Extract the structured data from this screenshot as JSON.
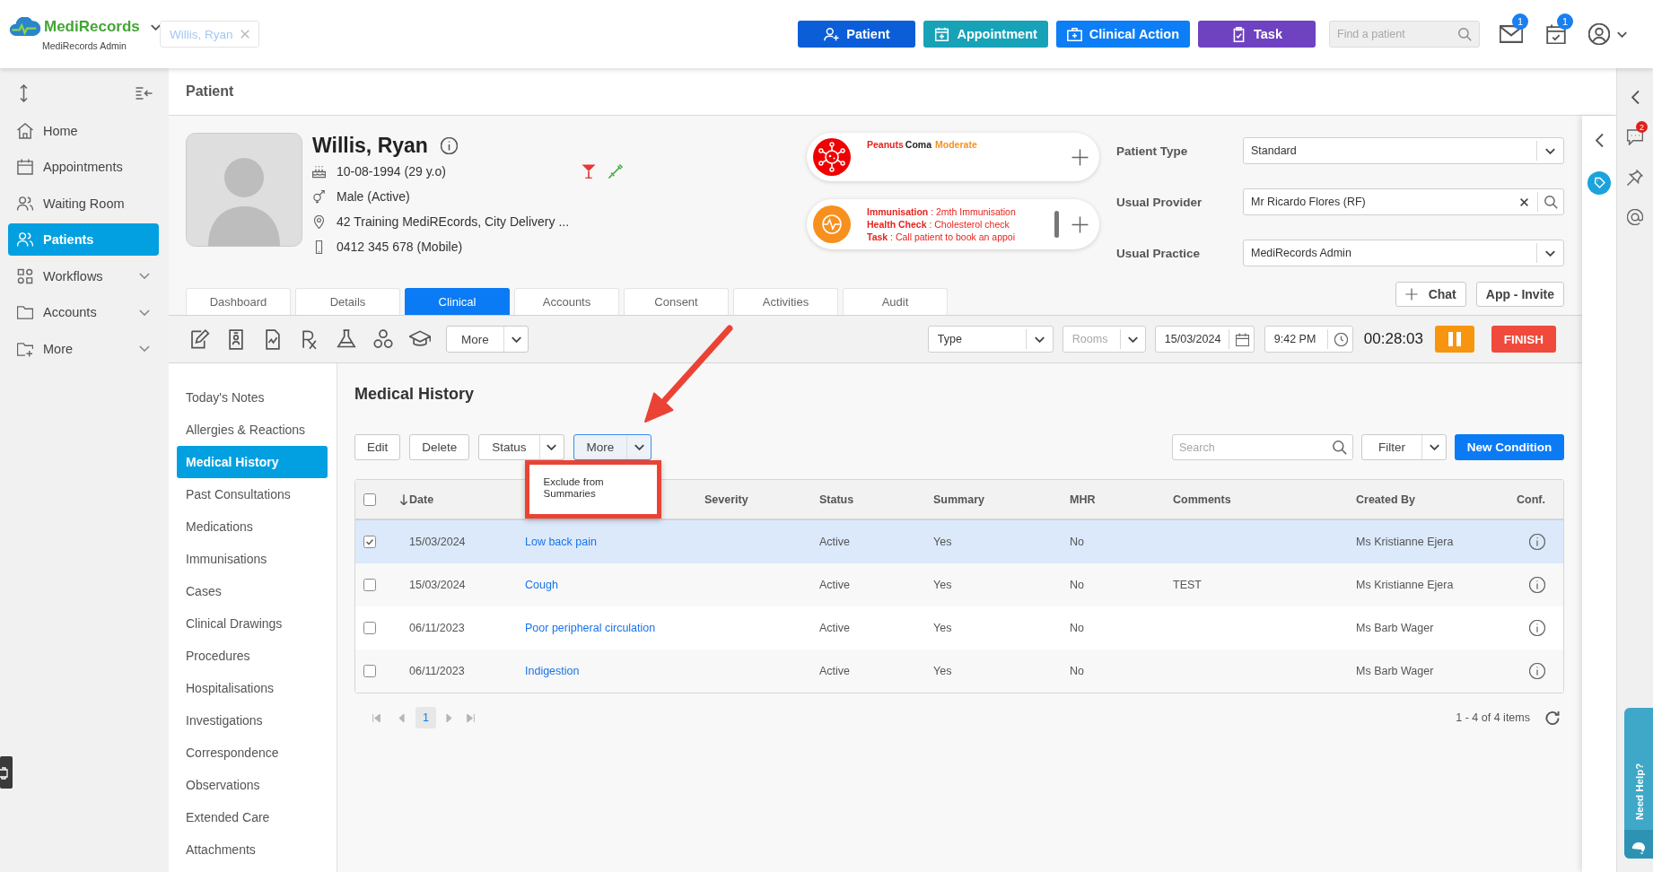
{
  "top_bar": {
    "brand": "MediRecords",
    "organisation": "MediRecords Admin",
    "open_patient": "Willis, Ryan",
    "actions": [
      {
        "label": "Patient",
        "color": "#0b5ed7"
      },
      {
        "label": "Appointment",
        "color": "#17a2b8"
      },
      {
        "label": "Clinical Action",
        "color": "#0d7ef5"
      },
      {
        "label": "Task",
        "color": "#6f42c1"
      }
    ],
    "search": {
      "placeholder": "Find a patient"
    },
    "notifications": [
      {
        "kind": "mail",
        "badge": "1"
      },
      {
        "kind": "calendar",
        "badge": "1"
      }
    ]
  },
  "sidebar": {
    "items": [
      {
        "label": "Home",
        "kind": "link",
        "selected": false
      },
      {
        "label": "Appointments",
        "kind": "link",
        "selected": false
      },
      {
        "label": "Waiting Room",
        "kind": "link",
        "selected": false
      },
      {
        "label": "Patients",
        "kind": "link",
        "selected": true
      },
      {
        "label": "Workflows",
        "kind": "group",
        "selected": false
      },
      {
        "label": "Accounts",
        "kind": "group",
        "selected": false
      },
      {
        "label": "More",
        "kind": "group",
        "selected": false
      }
    ]
  },
  "page": {
    "title": "Patient"
  },
  "patient": {
    "name": "Willis, Ryan",
    "dob": "10-08-1994 (29 y.o)",
    "gender": "Male (Active)",
    "address": "42 Training MediREcords, City Delivery ...",
    "phone": "0412 345 678 (Mobile)"
  },
  "alert_cards": [
    {
      "kind": "allergy",
      "substance": "Peanuts",
      "reaction": "Coma",
      "severity": "Moderate"
    },
    {
      "kind": "reminders",
      "lines": [
        "**Immunisation** : 2mth Immunisation",
        "**Health Check** : Cholesterol check",
        "**Task** : Call patient to book an appoi"
      ]
    }
  ],
  "patient_fields": [
    {
      "label": "Patient Type",
      "value": "Standard",
      "kind": "select"
    },
    {
      "label": "Usual Provider",
      "value": "Mr Ricardo Flores (RF)",
      "kind": "lookup"
    },
    {
      "label": "Usual Practice",
      "value": "MediRecords Admin",
      "kind": "select"
    }
  ],
  "patient_buttons": [
    {
      "label": "Chat",
      "kind": "add"
    },
    {
      "label": "App - Invite",
      "kind": "plain"
    }
  ],
  "tabs": [
    {
      "label": "Dashboard",
      "selected": false
    },
    {
      "label": "Details",
      "selected": false
    },
    {
      "label": "Clinical",
      "selected": true
    },
    {
      "label": "Accounts",
      "selected": false
    },
    {
      "label": "Consent",
      "selected": false
    },
    {
      "label": "Activities",
      "selected": false
    },
    {
      "label": "Audit",
      "selected": false
    }
  ],
  "toolbar": {
    "more": "More",
    "type_select": {
      "value": "Type"
    },
    "rooms_select": {
      "placeholder": "Rooms"
    },
    "date": {
      "value": "15/03/2024"
    },
    "time": {
      "value": "9:42 PM"
    },
    "timer": "00:28:03",
    "finish": "FINISH"
  },
  "clinical_menu": {
    "items": [
      {
        "label": "Today's Notes",
        "selected": false
      },
      {
        "label": "Allergies & Reactions",
        "selected": false
      },
      {
        "label": "Medical History",
        "selected": true
      },
      {
        "label": "Past Consultations",
        "selected": false
      },
      {
        "label": "Medications",
        "selected": false
      },
      {
        "label": "Immunisations",
        "selected": false
      },
      {
        "label": "Cases",
        "selected": false
      },
      {
        "label": "Clinical Drawings",
        "selected": false
      },
      {
        "label": "Procedures",
        "selected": false
      },
      {
        "label": "Hospitalisations",
        "selected": false
      },
      {
        "label": "Investigations",
        "selected": false
      },
      {
        "label": "Correspondence",
        "selected": false
      },
      {
        "label": "Observations",
        "selected": false
      },
      {
        "label": "Extended Care",
        "selected": false
      },
      {
        "label": "Attachments",
        "selected": false
      }
    ]
  },
  "medical_history": {
    "title": "Medical History",
    "actions": [
      {
        "label": "Edit",
        "kind": "button",
        "open": false
      },
      {
        "label": "Delete",
        "kind": "button",
        "open": false
      },
      {
        "label": "Status",
        "kind": "split",
        "open": false
      },
      {
        "label": "More",
        "kind": "split",
        "open": true
      }
    ],
    "menu": {
      "items": [
        "Exclude from Summaries"
      ]
    },
    "search": {
      "placeholder": "Search"
    },
    "filter": "Filter",
    "new_button": "New Condition",
    "table": {
      "all_checked": false,
      "columns": [
        {
          "label": "Date",
          "kind": "text",
          "sorted": true
        },
        {
          "kind": "link"
        },
        {
          "label": "Severity",
          "kind": "text",
          "sorted": false
        },
        {
          "label": "Status",
          "kind": "text",
          "sorted": false
        },
        {
          "label": "Summary",
          "kind": "text",
          "sorted": false
        },
        {
          "label": "MHR",
          "kind": "text",
          "sorted": false
        },
        {
          "label": "Comments",
          "kind": "text",
          "sorted": false
        },
        {
          "label": "Created By",
          "kind": "text",
          "sorted": false
        },
        {
          "label": "Conf.",
          "kind": "info",
          "sorted": false
        }
      ],
      "rows": [
        {
          "selected": true,
          "checked": true,
          "date": "15/03/2024",
          "column_3": "Low back pain",
          "status": "Active",
          "summary": "Yes",
          "mhr": "No",
          "created_by": "Ms Kristianne Ejera"
        },
        {
          "selected": false,
          "checked": false,
          "date": "15/03/2024",
          "column_3": "Cough",
          "status": "Active",
          "summary": "Yes",
          "mhr": "No",
          "comments": "TEST",
          "created_by": "Ms Kristianne Ejera"
        },
        {
          "selected": false,
          "checked": false,
          "date": "06/11/2023",
          "column_3": "Poor peripheral circulation",
          "status": "Active",
          "summary": "Yes",
          "mhr": "No",
          "created_by": "Ms Barb Wager"
        },
        {
          "selected": false,
          "checked": false,
          "date": "06/11/2023",
          "column_3": "Indigestion",
          "status": "Active",
          "summary": "Yes",
          "mhr": "No",
          "created_by": "Ms Barb Wager"
        }
      ]
    },
    "pagination": {
      "pages": [
        {
          "label": "1",
          "selected": true
        }
      ],
      "summary": "1 - 4 of 4 items"
    }
  },
  "right_rail": {
    "chat_badge": "2",
    "help": "Need Help?"
  }
}
